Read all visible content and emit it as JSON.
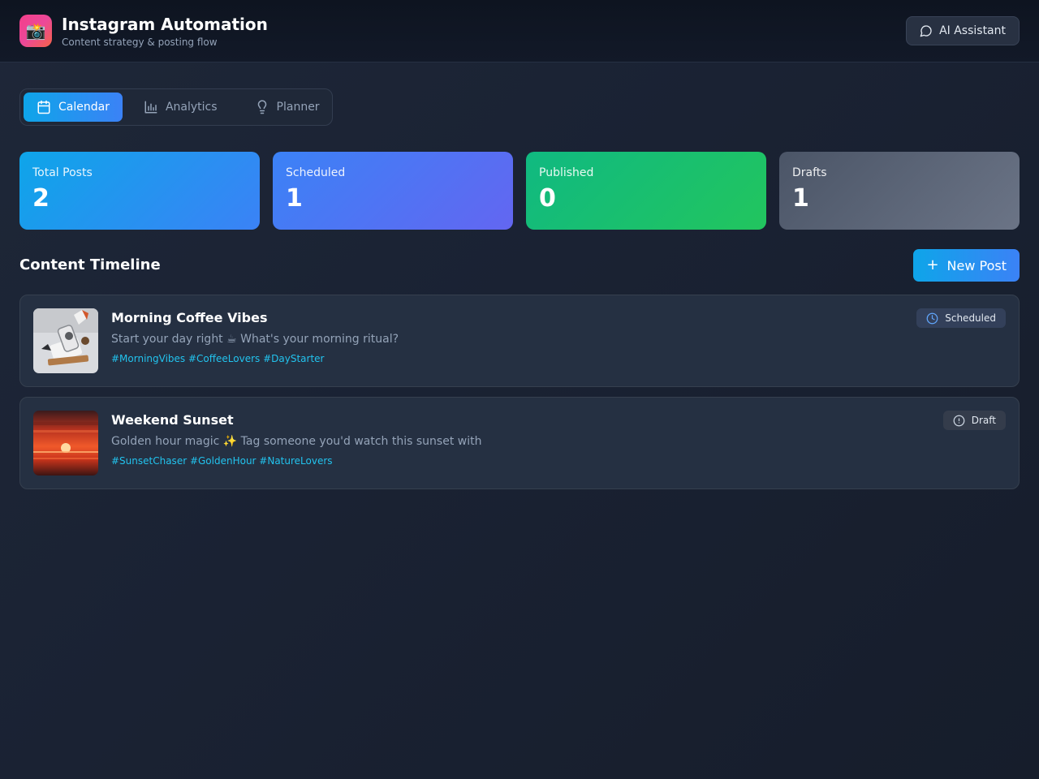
{
  "header": {
    "logo_glyph": "📸",
    "title": "Instagram Automation",
    "subtitle": "Content strategy & posting flow",
    "ai_button_label": "AI Assistant"
  },
  "tabs": [
    {
      "label": "Calendar",
      "icon": "calendar-icon",
      "active": true
    },
    {
      "label": "Analytics",
      "icon": "bar-chart-icon",
      "active": false
    },
    {
      "label": "Planner",
      "icon": "lightbulb-icon",
      "active": false
    }
  ],
  "stats": [
    {
      "label": "Total Posts",
      "value": "2"
    },
    {
      "label": "Scheduled",
      "value": "1"
    },
    {
      "label": "Published",
      "value": "0"
    },
    {
      "label": "Drafts",
      "value": "1"
    }
  ],
  "timeline": {
    "title": "Content Timeline",
    "new_post_label": "New Post",
    "posts": [
      {
        "title": "Morning Coffee Vibes",
        "caption": "Start your day right ☕ What's your morning ritual?",
        "hashtags": "#MorningVibes #CoffeeLovers #DayStarter",
        "status": "Scheduled",
        "status_icon": "clock-icon"
      },
      {
        "title": "Weekend Sunset",
        "caption": "Golden hour magic ✨ Tag someone you'd watch this sunset with",
        "hashtags": "#SunsetChaser #GoldenHour #NatureLovers",
        "status": "Draft",
        "status_icon": "alert-circle-icon"
      }
    ]
  },
  "colors": {
    "accent": "#3b82f6",
    "hashtag": "#22c3ee",
    "published": "#10b981"
  }
}
